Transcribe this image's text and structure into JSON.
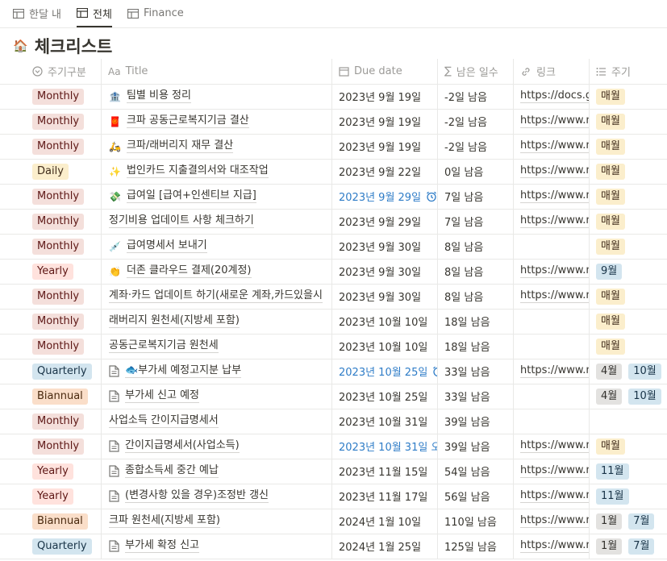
{
  "tabs": [
    {
      "label": "한달 내",
      "active": false
    },
    {
      "label": "전체",
      "active": true
    },
    {
      "label": "Finance",
      "active": false
    }
  ],
  "page": {
    "emoji": "🏠",
    "title": "체크리스트"
  },
  "columns": {
    "type": "주기구분",
    "title": "Title",
    "title_icon": "Aa",
    "due": "Due date",
    "remaining": "남은 일수",
    "link": "링크",
    "period": "주기"
  },
  "rows": [
    {
      "type": "Monthly",
      "title_icon": "🏦",
      "title": "팀별 비용 정리",
      "due": "2023년 9월 19일",
      "due_blue": false,
      "alarm": false,
      "remaining": "-2일 남음",
      "link": "https://docs.go",
      "period": [
        {
          "l": "매월",
          "c": "yellow"
        }
      ]
    },
    {
      "type": "Monthly",
      "title_icon": "🧧",
      "title": "크파 공동근로복지기금 결산",
      "due": "2023년 9월 19일",
      "due_blue": false,
      "alarm": false,
      "remaining": "-2일 남음",
      "link": "https://www.no",
      "period": [
        {
          "l": "매월",
          "c": "yellow"
        }
      ]
    },
    {
      "type": "Monthly",
      "title_icon": "🛵",
      "title": "크파/래버리지 재무 결산",
      "due": "2023년 9월 19일",
      "due_blue": false,
      "alarm": false,
      "remaining": "-2일 남음",
      "link": "https://www.no",
      "period": [
        {
          "l": "매월",
          "c": "yellow"
        }
      ]
    },
    {
      "type": "Daily",
      "title_icon": "✨",
      "title": "법인카드 지출결의서와 대조작업",
      "due": "2023년 9월 22일",
      "due_blue": false,
      "alarm": false,
      "remaining": "0일 남음",
      "link": "https://www.no",
      "period": [
        {
          "l": "매월",
          "c": "yellow"
        }
      ]
    },
    {
      "type": "Monthly",
      "title_icon": "💸",
      "title": "급여일 [급여+인센티브 지급]",
      "due": "2023년 9월 29일",
      "due_blue": true,
      "alarm": true,
      "remaining": "7일 남음",
      "link": "https://www.no",
      "period": [
        {
          "l": "매월",
          "c": "yellow"
        }
      ]
    },
    {
      "type": "Monthly",
      "title_icon": "",
      "title": "정기비용 업데이트 사항 체크하기",
      "due": "2023년 9월 29일",
      "due_blue": false,
      "alarm": false,
      "remaining": "7일 남음",
      "link": "https://www.no",
      "period": [
        {
          "l": "매월",
          "c": "yellow"
        }
      ]
    },
    {
      "type": "Monthly",
      "title_icon": "💉",
      "title": "급여명세서 보내기",
      "due": "2023년 9월 30일",
      "due_blue": false,
      "alarm": false,
      "remaining": "8일 남음",
      "link": "",
      "period": [
        {
          "l": "매월",
          "c": "yellow"
        }
      ]
    },
    {
      "type": "Yearly",
      "title_icon": "👏",
      "title": "더존 클라우드 결제(20계정)",
      "due": "2023년 9월 30일",
      "due_blue": false,
      "alarm": false,
      "remaining": "8일 남음",
      "link": "https://www.no",
      "period": [
        {
          "l": "9월",
          "c": "blue"
        }
      ]
    },
    {
      "type": "Monthly",
      "title_icon": "",
      "title": "계좌·카드 업데이트 하기(새로운 계좌,카드있을시",
      "due": "2023년 9월 30일",
      "due_blue": false,
      "alarm": false,
      "remaining": "8일 남음",
      "link": "https://www.no",
      "period": [
        {
          "l": "매월",
          "c": "yellow"
        }
      ]
    },
    {
      "type": "Monthly",
      "title_icon": "",
      "title": "래버리지 원천세(지방세 포함)",
      "due": "2023년 10월 10일",
      "due_blue": false,
      "alarm": false,
      "remaining": "18일 남음",
      "link": "",
      "period": [
        {
          "l": "매월",
          "c": "yellow"
        }
      ]
    },
    {
      "type": "Monthly",
      "title_icon": "",
      "title": "공동근로복지기금 원천세",
      "due": "2023년 10월 10일",
      "due_blue": false,
      "alarm": false,
      "remaining": "18일 남음",
      "link": "",
      "period": [
        {
          "l": "매월",
          "c": "yellow"
        }
      ]
    },
    {
      "type": "Quarterly",
      "title_icon": "page",
      "title": "🐟부가세 예정고지분 납부",
      "due": "2023년 10월 25일",
      "due_blue": true,
      "alarm": true,
      "remaining": "33일 남음",
      "link": "https://www.no",
      "period": [
        {
          "l": "4월",
          "c": "gray"
        },
        {
          "l": "10월",
          "c": "blue"
        }
      ]
    },
    {
      "type": "Biannual",
      "title_icon": "page",
      "title": "부가세 신고 예정",
      "due": "2023년 10월 25일",
      "due_blue": false,
      "alarm": false,
      "remaining": "33일 남음",
      "link": "",
      "period": [
        {
          "l": "4월",
          "c": "gray"
        },
        {
          "l": "10월",
          "c": "blue"
        }
      ]
    },
    {
      "type": "Monthly",
      "title_icon": "",
      "title": "사업소득 간이지급명세서",
      "due": "2023년 10월 31일",
      "due_blue": false,
      "alarm": false,
      "remaining": "39일 남음",
      "link": "",
      "period": []
    },
    {
      "type": "Monthly",
      "title_icon": "page",
      "title": "간이지급명세서(사업소득)",
      "due": "2023년 10월 31일 오",
      "due_blue": true,
      "alarm": false,
      "remaining": "39일 남음",
      "link": "https://www.no",
      "period": [
        {
          "l": "매월",
          "c": "yellow"
        }
      ]
    },
    {
      "type": "Yearly",
      "title_icon": "page",
      "title": "종합소득세 중간 예납",
      "due": "2023년 11월 15일",
      "due_blue": false,
      "alarm": false,
      "remaining": "54일 남음",
      "link": "https://www.no",
      "period": [
        {
          "l": "11월",
          "c": "blue"
        }
      ]
    },
    {
      "type": "Yearly",
      "title_icon": "page",
      "title": "(변경사항 있을 경우)조정반 갱신",
      "due": "2023년 11월 17일",
      "due_blue": false,
      "alarm": false,
      "remaining": "56일 남음",
      "link": "https://www.no",
      "period": [
        {
          "l": "11월",
          "c": "blue"
        }
      ]
    },
    {
      "type": "Biannual",
      "title_icon": "",
      "title": "크파 원천세(지방세 포함)",
      "due": "2024년 1월 10일",
      "due_blue": false,
      "alarm": false,
      "remaining": "110일 남음",
      "link": "https://www.no",
      "period": [
        {
          "l": "1월",
          "c": "gray"
        },
        {
          "l": "7월",
          "c": "blue"
        }
      ]
    },
    {
      "type": "Quarterly",
      "title_icon": "page",
      "title": "부가세 확정 신고",
      "due": "2024년 1월 25일",
      "due_blue": false,
      "alarm": false,
      "remaining": "125일 남음",
      "link": "https://www.no",
      "period": [
        {
          "l": "1월",
          "c": "gray"
        },
        {
          "l": "7월",
          "c": "blue"
        }
      ]
    }
  ]
}
